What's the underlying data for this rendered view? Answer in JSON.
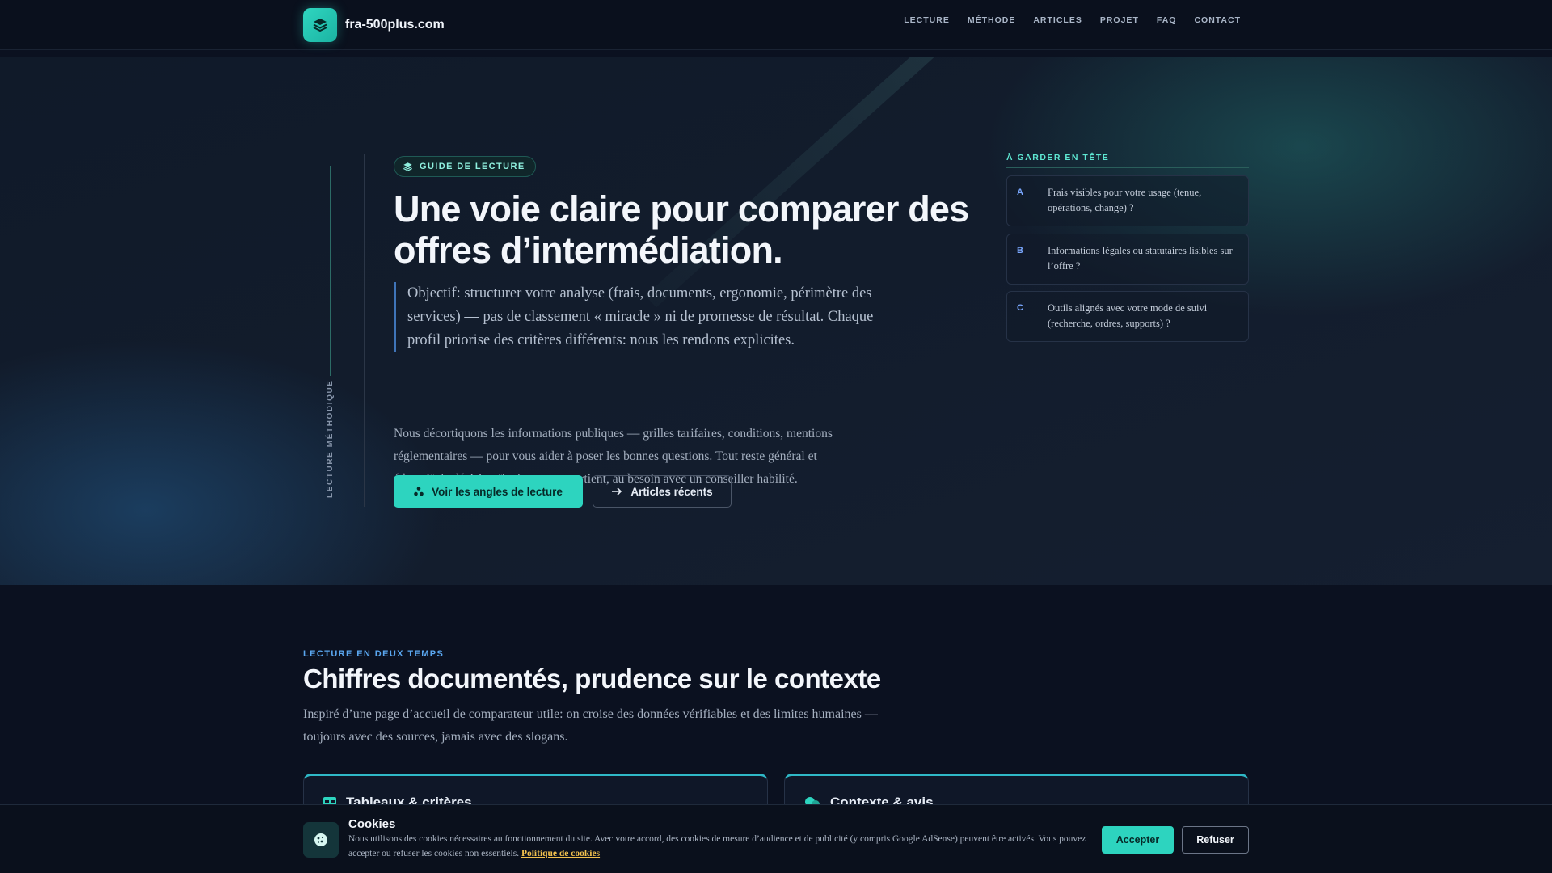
{
  "brand": {
    "name": "fra-500plus.com",
    "icon": "layers-icon"
  },
  "nav": {
    "links": [
      "LECTURE",
      "MÉTHODE",
      "ARTICLES",
      "PROJET",
      "FAQ",
      "CONTACT"
    ]
  },
  "hero": {
    "vertical_label": "LECTURE MÉTHODIQUE",
    "badge": "GUIDE DE LECTURE",
    "title": "Une voie claire pour comparer des offres d’intermédiation.",
    "quote": "Objectif: structurer votre analyse (frais, documents, ergonomie, périmètre des services) — pas de classement « miracle » ni de promesse de résultat. Chaque profil priorise des critères différents: nous les rendons explicites.",
    "body": "Nous décortiquons les informations publiques — grilles tarifaires, conditions, mentions réglementaires — pour vous aider à poser les bonnes questions. Tout reste général et éducatif: la décision finale vous appartient, au besoin avec un conseiller habilité.",
    "primary_button": "Voir les angles de lecture",
    "secondary_button": "Articles récents"
  },
  "aside": {
    "title": "À GARDER EN TÊTE",
    "items": [
      {
        "letter": "A",
        "text": "Frais visibles pour votre usage (tenue, opérations, change) ?"
      },
      {
        "letter": "B",
        "text": "Informations légales ou statutaires lisibles sur l’offre ?"
      },
      {
        "letter": "C",
        "text": "Outils alignés avec votre mode de suivi (recherche, ordres, supports) ?"
      }
    ]
  },
  "section": {
    "eyebrow": "LECTURE EN DEUX TEMPS",
    "title": "Chiffres documentés, prudence sur le contexte",
    "lead": "Inspiré d’une page d’accueil de comparateur utile: on croise des données vérifiables et des limites humaines — toujours avec des sources, jamais avec des slogans.",
    "cards": [
      {
        "title": "Tableaux & critères",
        "icon": "table-icon"
      },
      {
        "title": "Contexte & avis",
        "icon": "chat-icon"
      }
    ]
  },
  "cookies": {
    "title": "Cookies",
    "text": "Nous utilisons des cookies nécessaires au fonctionnement du site. Avec votre accord, des cookies de mesure d’audience et de publicité (y compris Google AdSense) peuvent être activés. Vous pouvez accepter ou refuser les cookies non essentiels.",
    "link": "Politique de cookies",
    "accept": "Accepter",
    "refuse": "Refuser"
  },
  "colors": {
    "accent": "#2dd4bf",
    "background": "#0b1120",
    "link": "#f2c14e",
    "eyebrow": "#5aa7f0"
  }
}
